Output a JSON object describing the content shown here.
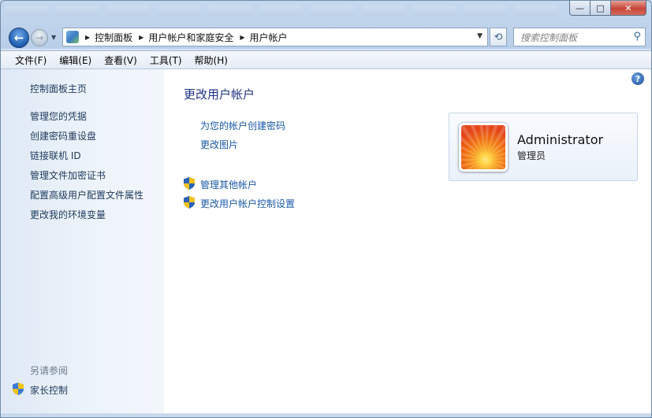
{
  "window": {
    "buttons": {
      "minimize": "—",
      "maximize": "□",
      "close": "✕"
    }
  },
  "navbar": {
    "back_glyph": "←",
    "forward_glyph": "→",
    "breadcrumb": [
      "控制面板",
      "用户帐户和家庭安全",
      "用户帐户"
    ],
    "search_placeholder": "搜索控制面板"
  },
  "menu": [
    "文件(F)",
    "编辑(E)",
    "查看(V)",
    "工具(T)",
    "帮助(H)"
  ],
  "sidebar": {
    "home": "控制面板主页",
    "links": [
      "管理您的凭据",
      "创建密码重设盘",
      "链接联机 ID",
      "管理文件加密证书",
      "配置高级用户配置文件属性",
      "更改我的环境变量"
    ],
    "see_also_header": "另请参阅",
    "see_also": [
      "家长控制"
    ]
  },
  "main": {
    "title": "更改用户帐户",
    "tasks": [
      "为您的帐户创建密码",
      "更改图片"
    ],
    "admin_tasks": [
      "管理其他帐户",
      "更改用户帐户控制设置"
    ],
    "help_glyph": "?"
  },
  "account": {
    "name": "Administrator",
    "role": "管理员"
  },
  "colors": {
    "link": "#1b59a8",
    "title": "#1e3287",
    "sidebar_text": "#1e395b"
  }
}
